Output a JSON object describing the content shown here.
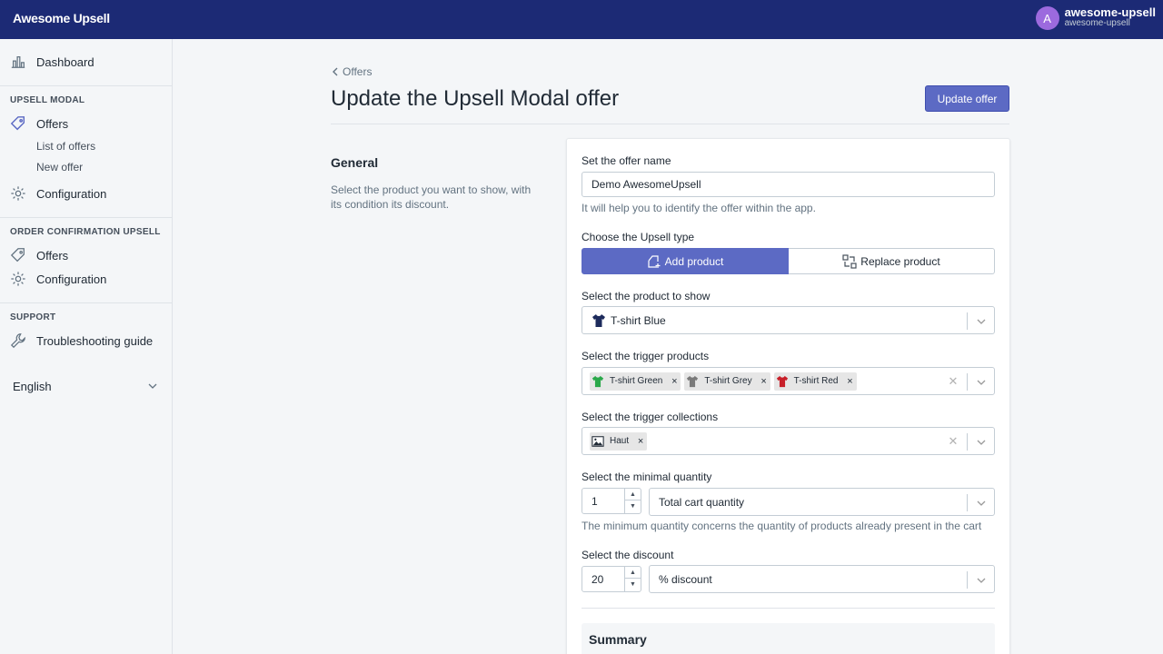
{
  "app": {
    "logo": "Awesome Upsell"
  },
  "user": {
    "initial": "A",
    "name": "awesome-upsell",
    "shop": "awesome-upsell"
  },
  "sidebar": {
    "dashboard": "Dashboard",
    "upsell_modal": {
      "title": "UPSELL MODAL",
      "offers": "Offers",
      "list_of_offers": "List of offers",
      "new_offer": "New offer",
      "configuration": "Configuration"
    },
    "order_confirmation": {
      "title": "ORDER CONFIRMATION UPSELL",
      "offers": "Offers",
      "configuration": "Configuration"
    },
    "support": {
      "title": "SUPPORT",
      "troubleshooting": "Troubleshooting guide"
    },
    "language": "English"
  },
  "page": {
    "breadcrumb": "Offers",
    "title": "Update the Upsell Modal offer",
    "update_button": "Update offer"
  },
  "general": {
    "heading": "General",
    "description": "Select the product you want to show, with its condition its discount."
  },
  "form": {
    "offer_name": {
      "label": "Set the offer name",
      "value": "Demo AwesomeUpsell",
      "help": "It will help you to identify the offer within the app."
    },
    "upsell_type": {
      "label": "Choose the Upsell type",
      "options": [
        "Add product",
        "Replace product"
      ],
      "selected": "Add product"
    },
    "product_to_show": {
      "label": "Select the product to show",
      "value": "T-shirt Blue"
    },
    "trigger_products": {
      "label": "Select the trigger products",
      "chips": [
        "T-shirt Green",
        "T-shirt Grey",
        "T-shirt Red"
      ]
    },
    "trigger_collections": {
      "label": "Select the trigger collections",
      "chips": [
        "Haut"
      ]
    },
    "minimal_quantity": {
      "label": "Select the minimal quantity",
      "value": "1",
      "type": "Total cart quantity",
      "help": "The minimum quantity concerns the quantity of products already present in the cart"
    },
    "discount": {
      "label": "Select the discount",
      "value": "20",
      "type": "% discount"
    },
    "summary": {
      "title": "Summary"
    }
  },
  "colors": {
    "topbar": "#1c2a75",
    "primary": "#5c6ac4",
    "shirt_blue": "#1d2b5c",
    "shirt_green": "#2aa84a",
    "shirt_grey": "#7a7a7a",
    "shirt_red": "#c8202a"
  }
}
